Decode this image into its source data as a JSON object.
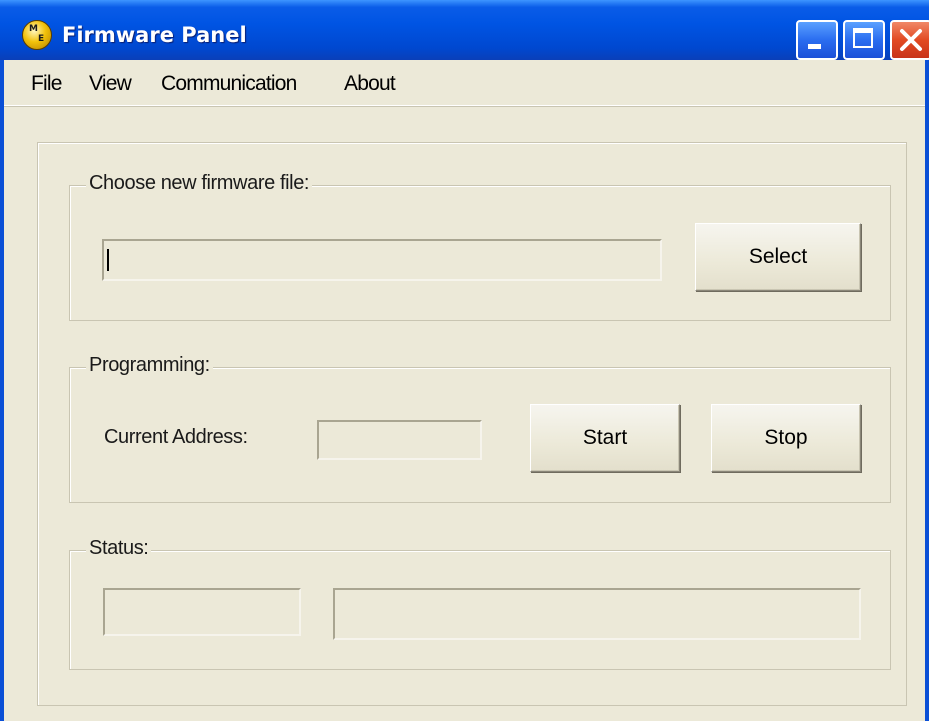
{
  "window": {
    "title": "Firmware Panel",
    "icon": "app-logo-icon",
    "controls": [
      "minimize-icon",
      "maximize-icon",
      "close-icon"
    ]
  },
  "menu": [
    "File",
    "View",
    "Communication",
    "About"
  ],
  "firmware_group": {
    "label": "Choose new firmware file:",
    "file_path_value": "",
    "select_label": "Select"
  },
  "programming_group": {
    "label": "Programming:",
    "address_label": "Current Address:",
    "address_value": "",
    "start_label": "Start",
    "stop_label": "Stop"
  },
  "status_group": {
    "label": "Status:",
    "status_code_value": "",
    "status_message_value": ""
  }
}
